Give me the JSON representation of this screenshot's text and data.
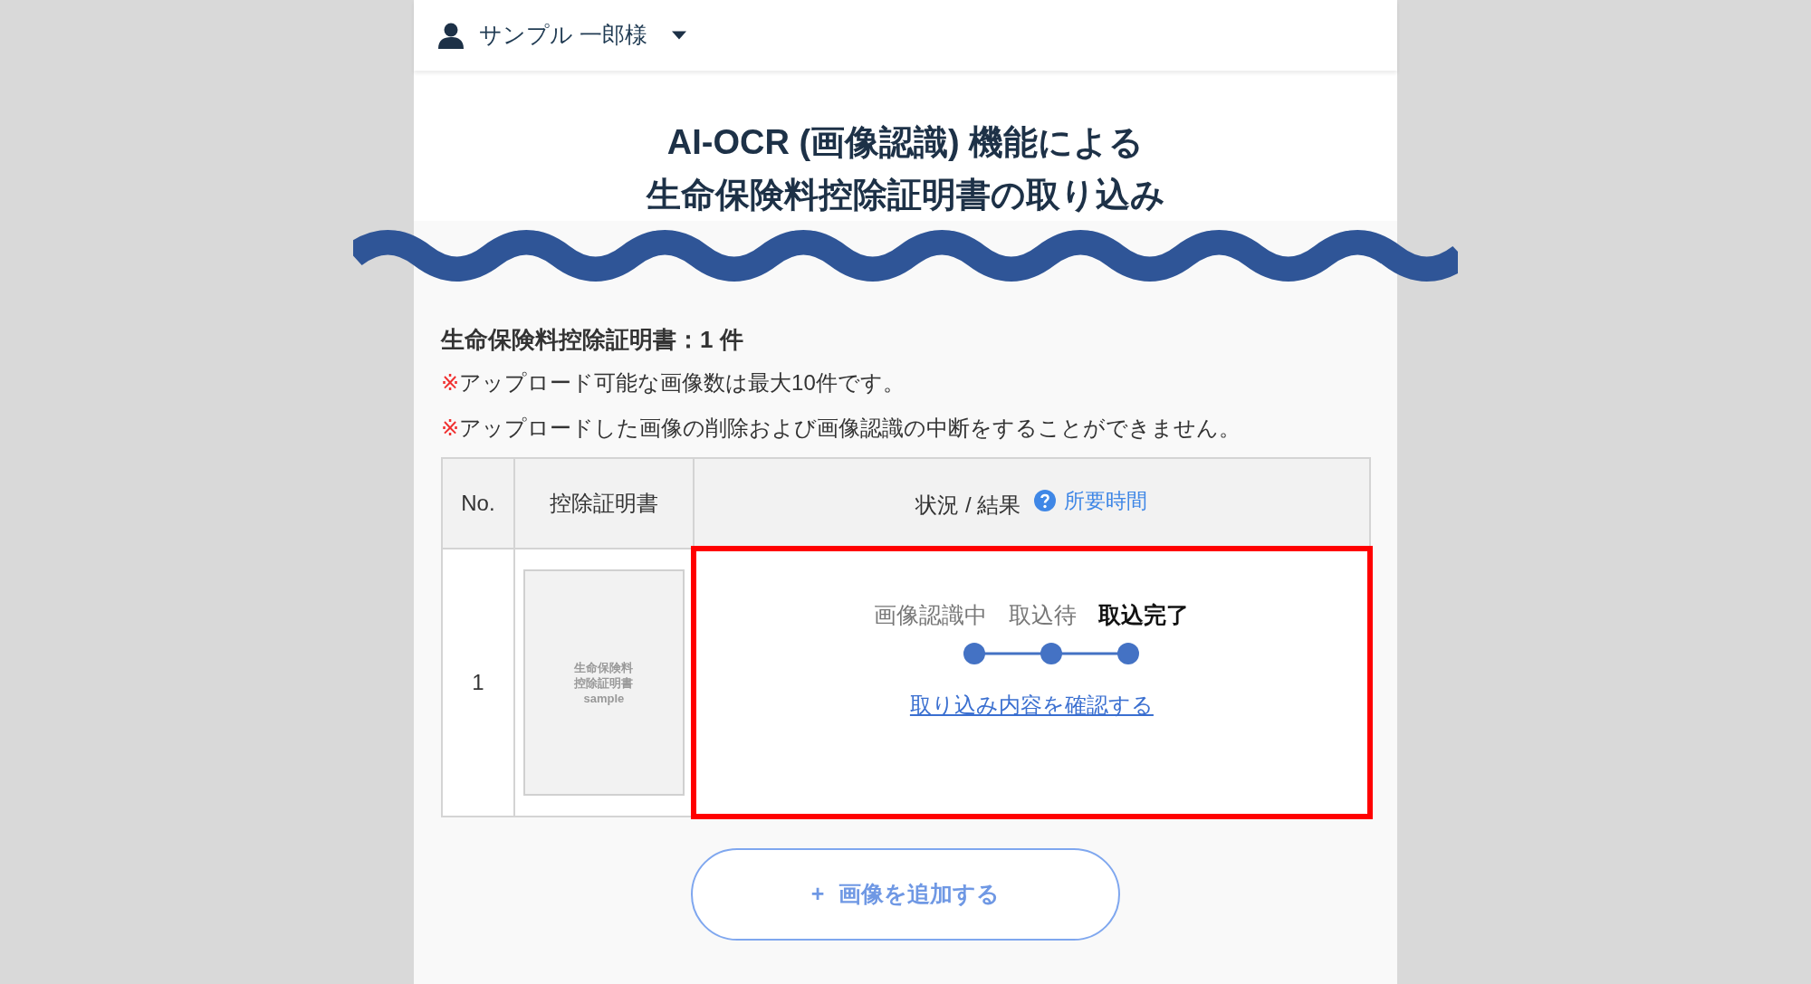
{
  "header": {
    "user_name": "サンプル 一郎様",
    "menu_expanded": false
  },
  "title_lines": [
    "AI-OCR (画像認識) 機能による",
    "生命保険料控除証明書の取り込み"
  ],
  "summary": "生命保険料控除証明書：1 件",
  "notes": [
    {
      "mark": "※",
      "text": "アップロード可能な画像数は最大10件です。"
    },
    {
      "mark": "※",
      "text": "アップロードした画像の削除および画像認識の中断をすることができません。"
    }
  ],
  "table": {
    "columns": [
      {
        "label": "No."
      },
      {
        "label": "控除証明書"
      },
      {
        "label": "状況 / 結果",
        "help_link": "所要時間"
      }
    ],
    "rows": [
      {
        "no": "1",
        "thumbnail_lines": [
          "生命保険料",
          "控除証明書",
          "sample"
        ],
        "highlighted": true,
        "steps": [
          {
            "label": "画像認識中",
            "selected": false
          },
          {
            "label": "取込待",
            "selected": false
          },
          {
            "label": "取込完了",
            "selected": true
          }
        ],
        "link": "取り込み内容を確認する"
      }
    ]
  },
  "add_button": {
    "icon": "+",
    "label": "画像を追加する"
  }
}
